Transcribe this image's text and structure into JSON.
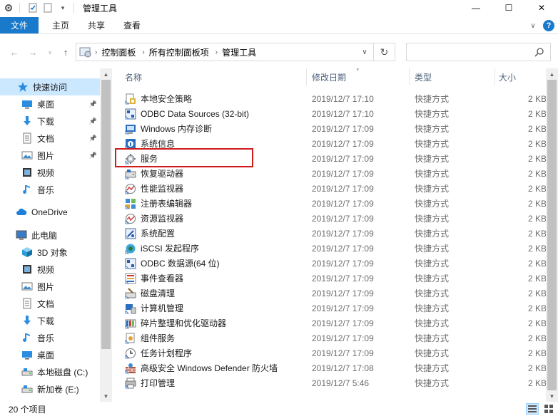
{
  "window": {
    "title": "管理工具",
    "controls": {
      "minimize": "—",
      "maximize": "☐",
      "close": "✕"
    }
  },
  "ribbon": {
    "tabs": [
      "文件",
      "主页",
      "共享",
      "查看"
    ],
    "help": "?"
  },
  "address": {
    "crumbs": [
      "控制面板",
      "所有控制面板项",
      "管理工具"
    ],
    "search_placeholder": ""
  },
  "nav_pane": {
    "items": [
      {
        "label": "快速访问",
        "icon": "star-icon",
        "indent": 0,
        "selected": true,
        "pinned": false
      },
      {
        "label": "桌面",
        "icon": "desktop-icon",
        "indent": 1,
        "selected": false,
        "pinned": true
      },
      {
        "label": "下载",
        "icon": "download-icon",
        "indent": 1,
        "selected": false,
        "pinned": true
      },
      {
        "label": "文档",
        "icon": "document-icon",
        "indent": 1,
        "selected": false,
        "pinned": true
      },
      {
        "label": "图片",
        "icon": "picture-icon",
        "indent": 1,
        "selected": false,
        "pinned": true
      },
      {
        "label": "视频",
        "icon": "video-icon",
        "indent": 1,
        "selected": false,
        "pinned": false
      },
      {
        "label": "音乐",
        "icon": "music-icon",
        "indent": 1,
        "selected": false,
        "pinned": false
      },
      {
        "label": "OneDrive",
        "icon": "cloud-icon",
        "indent": 0,
        "selected": false,
        "pinned": false
      },
      {
        "label": "此电脑",
        "icon": "computer-icon",
        "indent": 0,
        "selected": false,
        "pinned": false
      },
      {
        "label": "3D 对象",
        "icon": "3d-objects-icon",
        "indent": 1,
        "selected": false,
        "pinned": false
      },
      {
        "label": "视频",
        "icon": "video-icon",
        "indent": 1,
        "selected": false,
        "pinned": false
      },
      {
        "label": "图片",
        "icon": "picture-icon",
        "indent": 1,
        "selected": false,
        "pinned": false
      },
      {
        "label": "文档",
        "icon": "document-icon",
        "indent": 1,
        "selected": false,
        "pinned": false
      },
      {
        "label": "下载",
        "icon": "download-icon",
        "indent": 1,
        "selected": false,
        "pinned": false
      },
      {
        "label": "音乐",
        "icon": "music-icon",
        "indent": 1,
        "selected": false,
        "pinned": false
      },
      {
        "label": "桌面",
        "icon": "desktop-icon",
        "indent": 1,
        "selected": false,
        "pinned": false
      },
      {
        "label": "本地磁盘 (C:)",
        "icon": "drive-icon",
        "indent": 1,
        "selected": false,
        "pinned": false
      },
      {
        "label": "新加卷 (E:)",
        "icon": "drive-icon",
        "indent": 1,
        "selected": false,
        "pinned": false
      }
    ]
  },
  "columns": {
    "name": "名称",
    "date": "修改日期",
    "type": "类型",
    "size": "大小"
  },
  "files": [
    {
      "name": "本地安全策略",
      "date": "2019/12/7 17:10",
      "type": "快捷方式",
      "size": "2 KB",
      "icon": "security-policy-icon"
    },
    {
      "name": "ODBC Data Sources (32-bit)",
      "date": "2019/12/7 17:10",
      "type": "快捷方式",
      "size": "2 KB",
      "icon": "odbc-icon"
    },
    {
      "name": "Windows 内存诊断",
      "date": "2019/12/7 17:09",
      "type": "快捷方式",
      "size": "2 KB",
      "icon": "memory-diagnostic-icon"
    },
    {
      "name": "系统信息",
      "date": "2019/12/7 17:09",
      "type": "快捷方式",
      "size": "2 KB",
      "icon": "system-info-icon"
    },
    {
      "name": "服务",
      "date": "2019/12/7 17:09",
      "type": "快捷方式",
      "size": "2 KB",
      "icon": "services-gear-icon"
    },
    {
      "name": "恢复驱动器",
      "date": "2019/12/7 17:09",
      "type": "快捷方式",
      "size": "2 KB",
      "icon": "recovery-drive-icon"
    },
    {
      "name": "性能监视器",
      "date": "2019/12/7 17:09",
      "type": "快捷方式",
      "size": "2 KB",
      "icon": "performance-monitor-icon"
    },
    {
      "name": "注册表编辑器",
      "date": "2019/12/7 17:09",
      "type": "快捷方式",
      "size": "2 KB",
      "icon": "registry-editor-icon"
    },
    {
      "name": "资源监视器",
      "date": "2019/12/7 17:09",
      "type": "快捷方式",
      "size": "2 KB",
      "icon": "resource-monitor-icon"
    },
    {
      "name": "系统配置",
      "date": "2019/12/7 17:09",
      "type": "快捷方式",
      "size": "2 KB",
      "icon": "system-config-icon"
    },
    {
      "name": "iSCSI 发起程序",
      "date": "2019/12/7 17:09",
      "type": "快捷方式",
      "size": "2 KB",
      "icon": "iscsi-icon"
    },
    {
      "name": "ODBC 数据源(64 位)",
      "date": "2019/12/7 17:09",
      "type": "快捷方式",
      "size": "2 KB",
      "icon": "odbc-icon"
    },
    {
      "name": "事件查看器",
      "date": "2019/12/7 17:09",
      "type": "快捷方式",
      "size": "2 KB",
      "icon": "event-viewer-icon"
    },
    {
      "name": "磁盘清理",
      "date": "2019/12/7 17:09",
      "type": "快捷方式",
      "size": "2 KB",
      "icon": "disk-cleanup-icon"
    },
    {
      "name": "计算机管理",
      "date": "2019/12/7 17:09",
      "type": "快捷方式",
      "size": "2 KB",
      "icon": "computer-management-icon"
    },
    {
      "name": "碎片整理和优化驱动器",
      "date": "2019/12/7 17:09",
      "type": "快捷方式",
      "size": "2 KB",
      "icon": "defrag-icon"
    },
    {
      "name": "组件服务",
      "date": "2019/12/7 17:09",
      "type": "快捷方式",
      "size": "2 KB",
      "icon": "component-services-icon"
    },
    {
      "name": "任务计划程序",
      "date": "2019/12/7 17:09",
      "type": "快捷方式",
      "size": "2 KB",
      "icon": "task-scheduler-icon"
    },
    {
      "name": "高级安全 Windows Defender 防火墙",
      "date": "2019/12/7 17:08",
      "type": "快捷方式",
      "size": "2 KB",
      "icon": "firewall-icon"
    },
    {
      "name": "打印管理",
      "date": "2019/12/7 5:46",
      "type": "快捷方式",
      "size": "2 KB",
      "icon": "print-management-icon"
    }
  ],
  "status": {
    "item_count": "20 个项目"
  },
  "colors": {
    "accent": "#1979ca",
    "selection": "#cce8ff",
    "highlight_border": "#d11a1a"
  }
}
